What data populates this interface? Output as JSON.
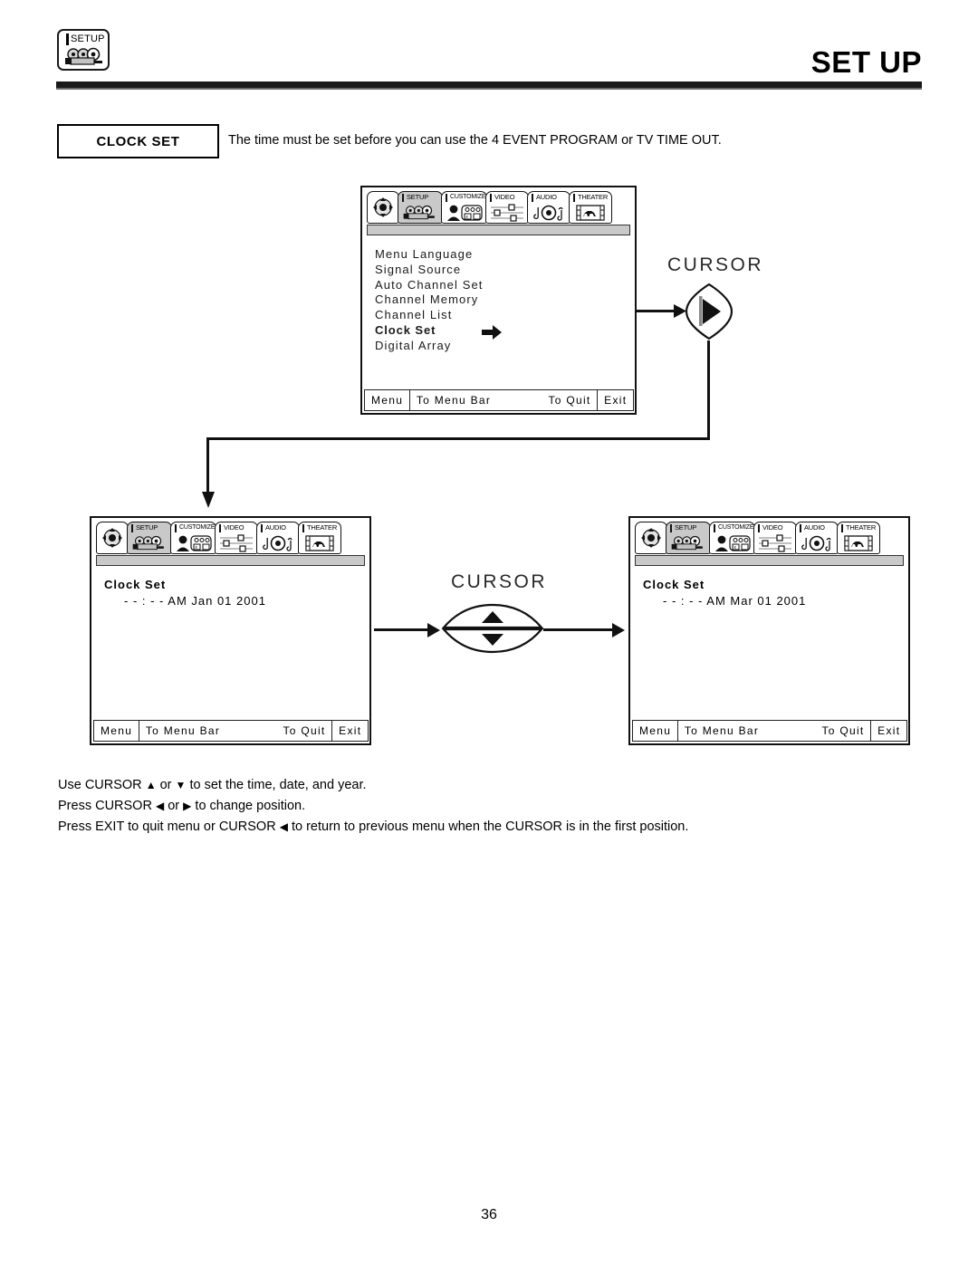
{
  "header": {
    "badge_label": "SETUP",
    "badge_icon": "camcorder-icon",
    "title": "SET UP"
  },
  "section": {
    "label": "CLOCK SET",
    "intro": "The time must be set before you can use the 4 EVENT PROGRAM or TV TIME OUT."
  },
  "tabs": [
    {
      "name": "nav-pad",
      "label": "",
      "icon": "dpad-icon",
      "selected": false
    },
    {
      "name": "setup",
      "label": "SETUP",
      "icon": "camcorder-icon",
      "selected": true
    },
    {
      "name": "customize",
      "label": "CUSTOMIZE",
      "icon": "person-icon",
      "selected": false
    },
    {
      "name": "video",
      "label": "VIDEO",
      "icon": "sliders-icon",
      "selected": false
    },
    {
      "name": "audio",
      "label": "AUDIO",
      "icon": "speaker-note-icon",
      "selected": false
    },
    {
      "name": "theater",
      "label": "THEATER",
      "icon": "film-horse-icon",
      "selected": false
    }
  ],
  "screen_menu": {
    "items": [
      {
        "label": "Menu Language",
        "active": false
      },
      {
        "label": "Signal Source",
        "active": false
      },
      {
        "label": "Auto Channel Set",
        "active": false
      },
      {
        "label": "Channel Memory",
        "active": false
      },
      {
        "label": "Channel List",
        "active": false
      },
      {
        "label": "Clock Set",
        "active": true
      },
      {
        "label": "Digital Array",
        "active": false
      }
    ],
    "pointer_icon": "right-arrow-icon",
    "footer": {
      "menu": "Menu",
      "to_menu_bar": "To Menu Bar",
      "to_quit": "To Quit",
      "exit": "Exit"
    }
  },
  "screen_clock_left": {
    "title": "Clock Set",
    "value": "- - : - - AM Jan 01 2001",
    "footer": {
      "menu": "Menu",
      "to_menu_bar": "To Menu Bar",
      "to_quit": "To Quit",
      "exit": "Exit"
    }
  },
  "screen_clock_right": {
    "title": "Clock Set",
    "value": "- - : - - AM Mar 01 2001",
    "footer": {
      "menu": "Menu",
      "to_menu_bar": "To Menu Bar",
      "to_quit": "To Quit",
      "exit": "Exit"
    }
  },
  "callouts": {
    "cursor_right_label": "CURSOR",
    "cursor_right_icon": "cursor-right-button-icon",
    "cursor_updown_label": "CURSOR",
    "cursor_up_icon": "cursor-up-button-icon",
    "cursor_down_icon": "cursor-down-button-icon"
  },
  "instructions": {
    "line1_a": "Use CURSOR ",
    "line1_up": "▲",
    "line1_b": " or ",
    "line1_down": "▼",
    "line1_c": " to set the time, date, and year.",
    "line2_a": "Press CURSOR ",
    "line2_left": "◀",
    "line2_b": " or ",
    "line2_right": "▶",
    "line2_c": " to change position.",
    "line3_a": "Press EXIT to quit menu or CURSOR ",
    "line3_left": "◀",
    "line3_b": " to return to previous menu when the CURSOR is in the first position."
  },
  "page_number": "36",
  "colors": {
    "ink": "#111111",
    "selected_tab": "#c9c9c9",
    "subbar": "#c9c9c9"
  }
}
